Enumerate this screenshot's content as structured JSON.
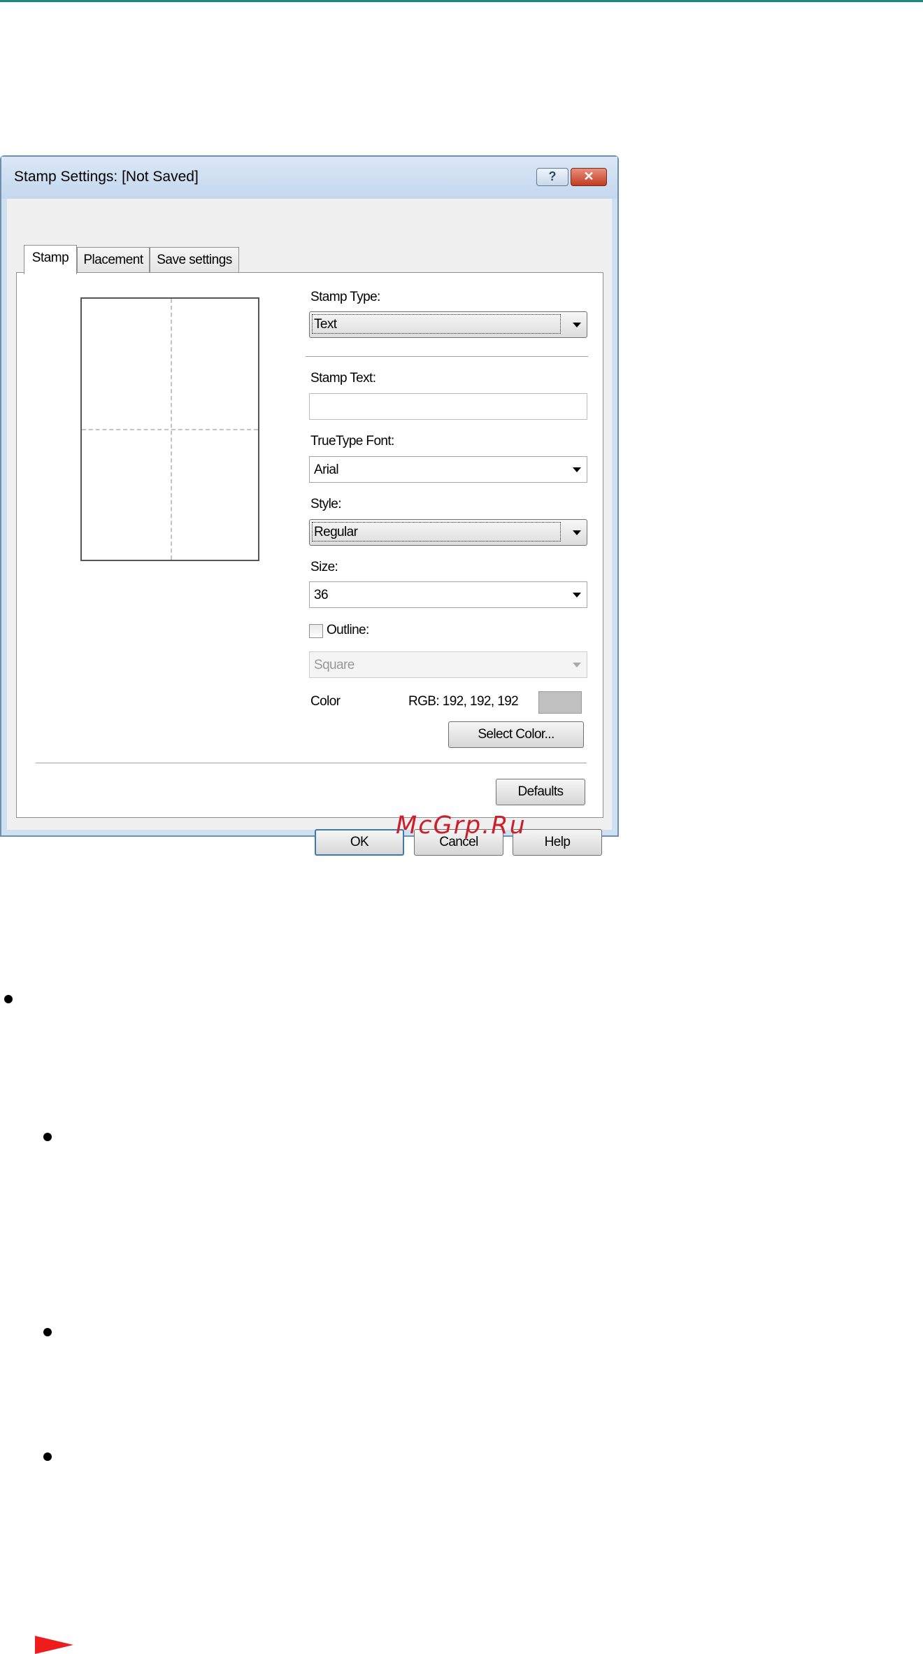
{
  "dialog": {
    "title": "Stamp Settings: [Not Saved]",
    "help_glyph": "?",
    "close_glyph": "✕",
    "tabs": [
      {
        "label": "Stamp"
      },
      {
        "label": "Placement"
      },
      {
        "label": "Save settings"
      }
    ],
    "stamp_type": {
      "label": "Stamp Type:",
      "value": "Text"
    },
    "stamp_text": {
      "label": "Stamp Text:",
      "value": ""
    },
    "truetype_font": {
      "label": "TrueType Font:",
      "value": "Arial"
    },
    "style": {
      "label": "Style:",
      "value": "Regular"
    },
    "size": {
      "label": "Size:",
      "value": "36"
    },
    "outline": {
      "label": "Outline:",
      "checked": false,
      "value": "Square"
    },
    "color": {
      "label": "Color",
      "rgb_text": "RGB: 192, 192, 192",
      "swatch": "#c0c0c0"
    },
    "select_color_label": "Select Color...",
    "defaults_label": "Defaults",
    "ok_label": "OK",
    "cancel_label": "Cancel",
    "help_label": "Help"
  },
  "watermark": "McGrp.Ru"
}
